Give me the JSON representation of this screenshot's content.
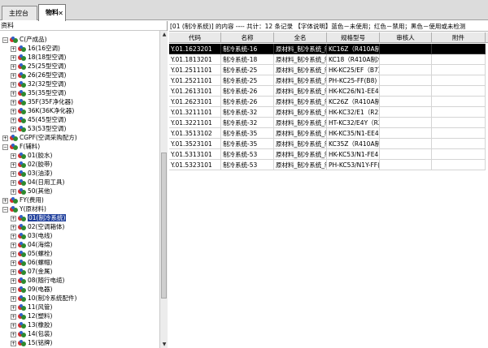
{
  "tabs": [
    {
      "label": "主控台"
    },
    {
      "label": "物料",
      "close": "✕"
    }
  ],
  "tree": {
    "title": "资料",
    "nodes": [
      {
        "label": "C(产成品)",
        "exp": "−"
      },
      {
        "label": "16(16空调)",
        "exp": "+"
      },
      {
        "label": "18(18型空调)",
        "exp": "+"
      },
      {
        "label": "25(25型空调)",
        "exp": "+"
      },
      {
        "label": "26(26型空调)",
        "exp": "+"
      },
      {
        "label": "32(32型空调)",
        "exp": "+"
      },
      {
        "label": "35(35型空调)",
        "exp": "+"
      },
      {
        "label": "35F(35F净化器)",
        "exp": "+"
      },
      {
        "label": "36K(36K净化器)",
        "exp": "+"
      },
      {
        "label": "45(45型空调)",
        "exp": "+"
      },
      {
        "label": "53(53型空调)",
        "exp": "+"
      },
      {
        "label": "CGPF(空调采购配方)",
        "exp": "+"
      },
      {
        "label": "F(辅料)",
        "exp": "−"
      },
      {
        "label": "01(胶水)",
        "exp": "+"
      },
      {
        "label": "02(胶带)",
        "exp": "+"
      },
      {
        "label": "03(油漆)",
        "exp": "+"
      },
      {
        "label": "04(日用工具)",
        "exp": "+"
      },
      {
        "label": "50(其他)",
        "exp": "+"
      },
      {
        "label": "FY(费用)",
        "exp": "+"
      },
      {
        "label": "Y(原材料)",
        "exp": "−"
      },
      {
        "label": "01(制冷系统)",
        "exp": "+",
        "selected": true
      },
      {
        "label": "02(空调箱体)",
        "exp": "+"
      },
      {
        "label": "03(电线)",
        "exp": "+"
      },
      {
        "label": "04(海绵)",
        "exp": "+"
      },
      {
        "label": "05(螺栓)",
        "exp": "+"
      },
      {
        "label": "06(螺帽)",
        "exp": "+"
      },
      {
        "label": "07(金属)",
        "exp": "+"
      },
      {
        "label": "08(随行电缆)",
        "exp": "+"
      },
      {
        "label": "09(电器)",
        "exp": "+"
      },
      {
        "label": "10(制冷系统配件)",
        "exp": "+"
      },
      {
        "label": "11(风管)",
        "exp": "+"
      },
      {
        "label": "12(塑料)",
        "exp": "+"
      },
      {
        "label": "13(橡胶)",
        "exp": "+"
      },
      {
        "label": "14(包装)",
        "exp": "+"
      },
      {
        "label": "15(铭牌)",
        "exp": "+"
      }
    ]
  },
  "info_text": "[01 (制冷系统)] 的内容 ---- 共计：12 条记录 【字体说明】蓝色－未使用；红色－禁用；黑色－使用或未检测",
  "grid": {
    "headers": [
      "代码",
      "名称",
      "全名",
      "规格型号",
      "审核人",
      "附件"
    ],
    "rows": [
      [
        "Y.01.1623201",
        "制冷系统-16",
        "原材料_制冷系统_制",
        "KC16Z（R410A制冷",
        "",
        ""
      ],
      [
        "Y.01.1813201",
        "制冷系统-18",
        "原材料_制冷系统_制",
        "KC18（R410A制冷",
        "",
        ""
      ],
      [
        "Y.01.2511101",
        "制冷系统-25",
        "原材料_制冷系统_制",
        "HK-KC25/EF（B7）",
        "",
        ""
      ],
      [
        "Y.01.2521101",
        "制冷系统-25",
        "原材料_制冷系统_制",
        "PH-KC25-FF(B8)（",
        "",
        ""
      ],
      [
        "Y.01.2613101",
        "制冷系统-26",
        "原材料_制冷系统_制",
        "HK-KC26/N1-EE4(8",
        "",
        ""
      ],
      [
        "Y.01.2623101",
        "制冷系统-26",
        "原材料_制冷系统_制",
        "KC26Z（R410A制冷",
        "",
        ""
      ],
      [
        "Y.01.3211101",
        "制冷系统-32",
        "原材料_制冷系统_制",
        "HK-KC32/E1（R22",
        "",
        ""
      ],
      [
        "Y.01.3221101",
        "制冷系统-32",
        "原材料_制冷系统_制",
        "HT-KC32/E4Y（R22",
        "",
        ""
      ],
      [
        "Y.01.3513102",
        "制冷系统-35",
        "原材料_制冷系统_制",
        "HK-KC35/N1-EE4(8",
        "",
        ""
      ],
      [
        "Y.01.3523101",
        "制冷系统-35",
        "原材料_制冷系统_制",
        "KC35Z（R410A制冷",
        "",
        ""
      ],
      [
        "Y.01.5313101",
        "制冷系统-53",
        "原材料_制冷系统_制",
        "HK-KC53/N1-FE4(8",
        "",
        ""
      ],
      [
        "Y.01.5323101",
        "制冷系统-53",
        "原材料_制冷系统_制",
        "PH-KC53/N1Y-FF(C",
        "",
        ""
      ]
    ],
    "selected_row": 0
  }
}
